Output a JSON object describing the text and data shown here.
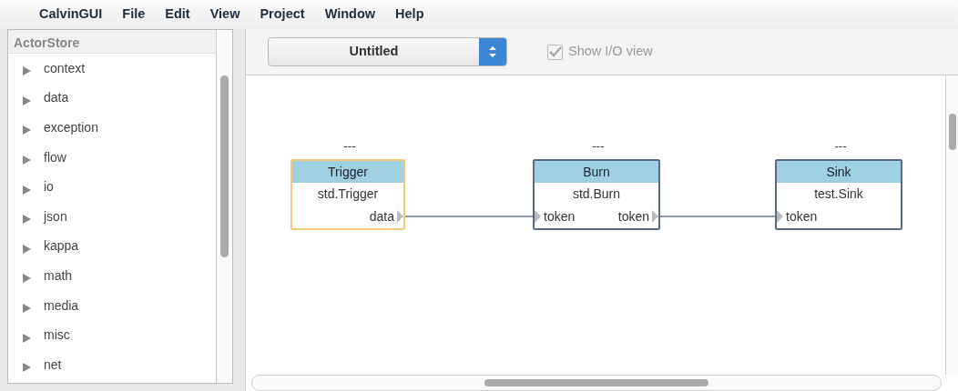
{
  "menu": [
    "CalvinGUI",
    "File",
    "Edit",
    "View",
    "Project",
    "Window",
    "Help"
  ],
  "sidebar": {
    "title": "ActorStore",
    "items": [
      {
        "label": "context",
        "expanded": false
      },
      {
        "label": "data",
        "expanded": false
      },
      {
        "label": "exception",
        "expanded": false
      },
      {
        "label": "flow",
        "expanded": false
      },
      {
        "label": "io",
        "expanded": false
      },
      {
        "label": "json",
        "expanded": false
      },
      {
        "label": "kappa",
        "expanded": false
      },
      {
        "label": "math",
        "expanded": false
      },
      {
        "label": "media",
        "expanded": false
      },
      {
        "label": "misc",
        "expanded": false
      },
      {
        "label": "net",
        "expanded": false
      }
    ]
  },
  "toolbar": {
    "app_select": "Untitled",
    "show_io": {
      "label": "Show I/O view",
      "checked": true,
      "disabled": true
    }
  },
  "actors": [
    {
      "caption": "---",
      "name": "Trigger",
      "type": "std.Trigger",
      "selected": true,
      "outports": [
        {
          "name": "data",
          "connected": true
        }
      ]
    },
    {
      "caption": "---",
      "name": "Burn",
      "type": "std.Burn",
      "selected": false,
      "inports": [
        "token"
      ],
      "outports": [
        {
          "name": "token",
          "connected": true
        }
      ]
    },
    {
      "caption": "---",
      "name": "Sink",
      "type": "test.Sink",
      "selected": false,
      "inports": [
        "token"
      ]
    }
  ]
}
